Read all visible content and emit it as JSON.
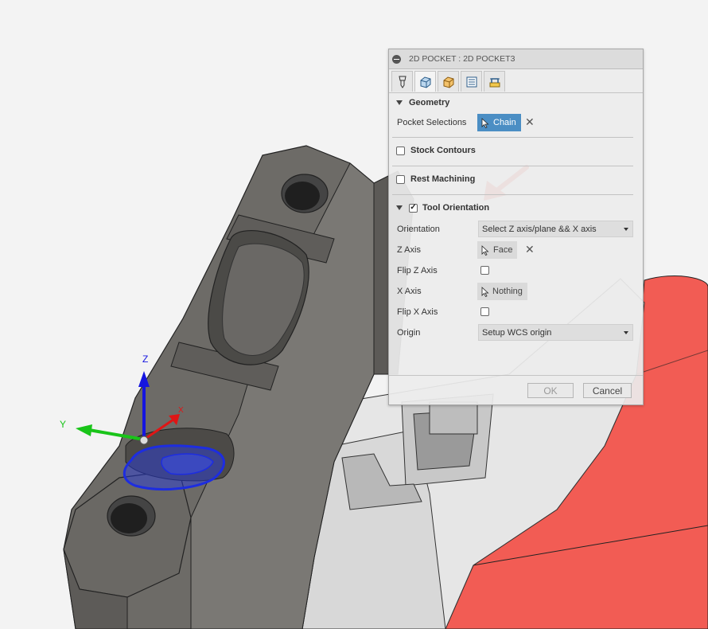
{
  "dialog": {
    "title": "2D POCKET : 2D POCKET3",
    "tabs": [
      "tool-icon",
      "geometry-icon",
      "heights-icon",
      "passes-icon",
      "linking-icon"
    ],
    "geometry": {
      "header": "Geometry",
      "pocket_selections_label": "Pocket Selections",
      "chain_button": "Chain"
    },
    "stock_contours": {
      "label": "Stock Contours",
      "checked": false
    },
    "rest_machining": {
      "label": "Rest Machining",
      "checked": false
    },
    "tool_orientation": {
      "label": "Tool Orientation",
      "checked": true,
      "orientation_label": "Orientation",
      "orientation_value": "Select Z axis/plane && X axis",
      "z_axis_label": "Z Axis",
      "z_axis_button": "Face",
      "flip_z_label": "Flip Z Axis",
      "x_axis_label": "X Axis",
      "x_axis_button": "Nothing",
      "flip_x_label": "Flip X Axis",
      "origin_label": "Origin",
      "origin_value": "Setup WCS origin"
    },
    "footer": {
      "ok": "OK",
      "cancel": "Cancel"
    }
  },
  "triad": {
    "z": "Z",
    "y": "Y",
    "x": "X"
  },
  "colors": {
    "accent": "#4b8ec4",
    "annotation_arrow": "#e8463c",
    "part_red": "#f25c54",
    "part_gray": "#6e6c68",
    "selection_blue": "#2233dd"
  }
}
